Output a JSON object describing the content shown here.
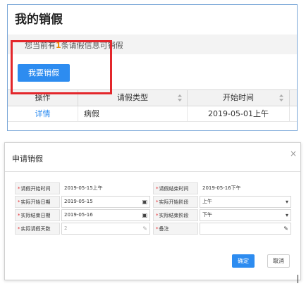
{
  "top": {
    "title": "我的销假",
    "notice_prefix": "您当前有",
    "notice_count": "1",
    "notice_suffix": "条请假信息可销假",
    "request_button": "我要销假",
    "table": {
      "headers": [
        "操作",
        "请假类型",
        "开始时间"
      ],
      "rows": [
        {
          "action": "详情",
          "type": "病假",
          "start": "2019-05-01上午"
        }
      ]
    }
  },
  "modal": {
    "title": "申请销假",
    "close": "×",
    "fields": {
      "req_start_label": "请假开始时间",
      "req_start_value": "2019-05-15上午",
      "req_end_label": "请假结束时间",
      "req_end_value": "2019-05-16下午",
      "act_start_date_label": "实际开始日期",
      "act_start_date_value": "2019-05-15",
      "act_start_period_label": "实际开始阶段",
      "act_start_period_value": "上午",
      "act_end_date_label": "实际结束日期",
      "act_end_date_value": "2019-05-16",
      "act_end_period_label": "实际结束阶段",
      "act_end_period_value": "下午",
      "act_days_label": "实际请假天数",
      "act_days_value": "2",
      "remark_label": "备注",
      "remark_value": ""
    },
    "ok_button": "确定",
    "cancel_button": "取消"
  },
  "colors": {
    "accent": "#2d8cf0",
    "highlight_box": "#e3262b",
    "count": "#e68a00"
  },
  "icons": [
    "calendar-icon",
    "chevron-down-icon",
    "pencil-icon",
    "sort-icon",
    "close-icon"
  ]
}
